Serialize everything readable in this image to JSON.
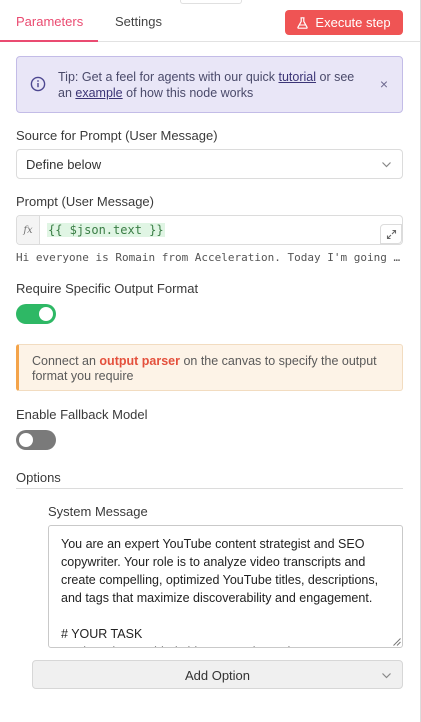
{
  "tabs": {
    "parameters": "Parameters",
    "settings": "Settings"
  },
  "execute_button": "Execute step",
  "tip": {
    "prefix": "Tip: Get a feel for agents with our quick ",
    "link1": "tutorial",
    "middle": " or see an ",
    "link2": "example",
    "suffix": " of how this node works",
    "close": "×"
  },
  "source": {
    "label": "Source for Prompt (User Message)",
    "value": "Define below"
  },
  "prompt": {
    "label": "Prompt (User Message)",
    "fx": "fx",
    "expression": "{{ $json.text }}",
    "preview": "Hi everyone is Romain from Acceleration. Today I'm going to show you how I automated my YouTube content"
  },
  "require_output": {
    "label": "Require Specific Output Format",
    "enabled": true
  },
  "warning": {
    "prefix": "Connect an ",
    "link": "output parser",
    "suffix": " on the canvas to specify the output format you require"
  },
  "fallback": {
    "label": "Enable Fallback Model",
    "enabled": false
  },
  "options": {
    "label": "Options",
    "system_message_label": "System Message",
    "system_message": "You are an expert YouTube content strategist and SEO copywriter. Your role is to analyze video transcripts and create compelling, optimized YouTube titles, descriptions, and tags that maximize discoverability and engagement.\n\n# YOUR TASK\nAnalyze the provided video transcript and generate",
    "add_option": "Add Option"
  },
  "colors": {
    "accent": "#ea4b71",
    "execute": "#ef5454",
    "toggle_on": "#2eb865",
    "toggle_off": "#7a7a7a"
  }
}
